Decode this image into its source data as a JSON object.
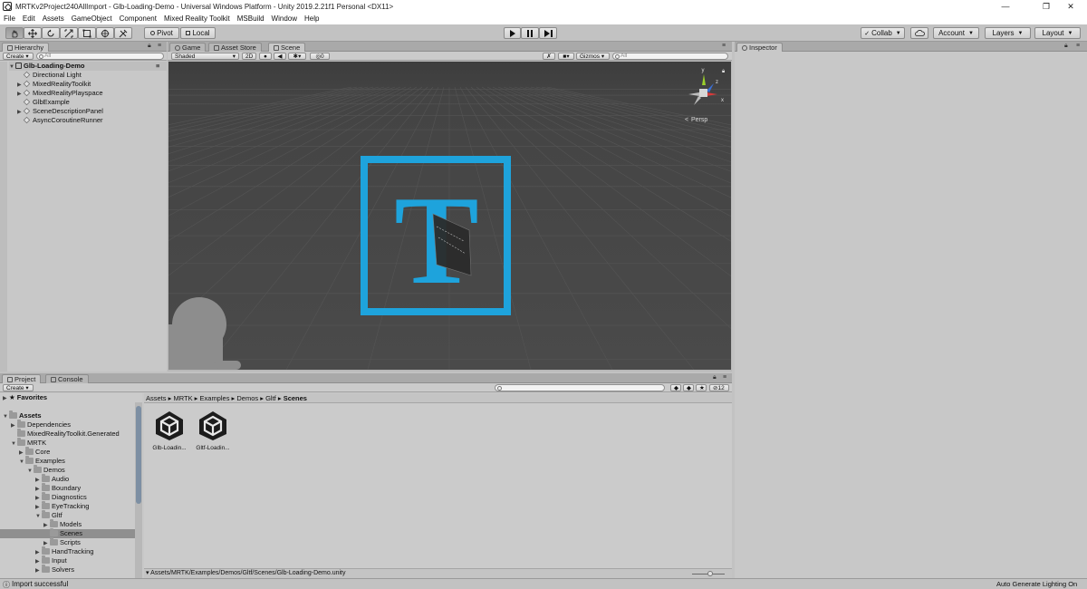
{
  "window": {
    "title": "MRTKv2Project240AllImport - Glb-Loading-Demo - Universal Windows Platform - Unity 2019.2.21f1 Personal <DX11>",
    "minimize_glyph": "—",
    "maximize_glyph": "❐",
    "close_glyph": "✕"
  },
  "menu": [
    "File",
    "Edit",
    "Assets",
    "GameObject",
    "Component",
    "Mixed Reality Toolkit",
    "MSBuild",
    "Window",
    "Help"
  ],
  "toolbar": {
    "pivot_label": "Pivot",
    "local_label": "Local",
    "collab_label": "Collab",
    "account_label": "Account",
    "layers_label": "Layers",
    "layout_label": "Layout"
  },
  "hierarchy": {
    "tab_label": "Hierarchy",
    "create_label": "Create",
    "search_placeholder": "All",
    "scene_name": "Glb-Loading-Demo",
    "items": [
      {
        "label": "Directional Light",
        "expandable": false
      },
      {
        "label": "MixedRealityToolkit",
        "expandable": true
      },
      {
        "label": "MixedRealityPlayspace",
        "expandable": true
      },
      {
        "label": "GlbExample",
        "expandable": false
      },
      {
        "label": "SceneDescriptionPanel",
        "expandable": true
      },
      {
        "label": "AsyncCoroutineRunner",
        "expandable": false
      }
    ]
  },
  "scene_view": {
    "tabs": [
      "Game",
      "Asset Store",
      "Scene"
    ],
    "active_tab": "Scene",
    "shading_mode": "Shaded",
    "mode_2d": "2D",
    "effects_count": "0",
    "gizmos_label": "Gizmos",
    "search_placeholder": "All",
    "projection_label": "Persp",
    "accent_color": "#1ea3dc",
    "axis_y_label": "y",
    "axis_x_label": "x",
    "axis_z_label": "z",
    "center_letter": "T"
  },
  "inspector": {
    "tab_label": "Inspector"
  },
  "project": {
    "tabs": [
      "Project",
      "Console"
    ],
    "create_label": "Create",
    "favorites_label": "Favorites",
    "assets_label": "Assets",
    "icon_size_value": "12",
    "breadcrumb": [
      "Assets",
      "MRTK",
      "Examples",
      "Demos",
      "Gltf",
      "Scenes"
    ],
    "tree": [
      {
        "label": "Dependencies",
        "level": 1,
        "arrow": "▶"
      },
      {
        "label": "MixedRealityToolkit.Generated",
        "level": 1,
        "arrow": ""
      },
      {
        "label": "MRTK",
        "level": 1,
        "arrow": "▼"
      },
      {
        "label": "Core",
        "level": 2,
        "arrow": "▶"
      },
      {
        "label": "Examples",
        "level": 2,
        "arrow": "▼"
      },
      {
        "label": "Demos",
        "level": 3,
        "arrow": "▼"
      },
      {
        "label": "Audio",
        "level": 4,
        "arrow": "▶"
      },
      {
        "label": "Boundary",
        "level": 4,
        "arrow": "▶"
      },
      {
        "label": "Diagnostics",
        "level": 4,
        "arrow": "▶"
      },
      {
        "label": "EyeTracking",
        "level": 4,
        "arrow": "▶"
      },
      {
        "label": "Gltf",
        "level": 4,
        "arrow": "▼"
      },
      {
        "label": "Models",
        "level": 5,
        "arrow": "▶"
      },
      {
        "label": "Scenes",
        "level": 5,
        "arrow": "",
        "selected": true
      },
      {
        "label": "Scripts",
        "level": 5,
        "arrow": "▶"
      },
      {
        "label": "HandTracking",
        "level": 4,
        "arrow": "▶"
      },
      {
        "label": "Input",
        "level": 4,
        "arrow": "▶"
      },
      {
        "label": "Solvers",
        "level": 4,
        "arrow": "▶"
      }
    ],
    "assets": [
      {
        "label": "Glb-Loadin..."
      },
      {
        "label": "Gltf-Loadin..."
      }
    ],
    "selected_path": "Assets/MRTK/Examples/Demos/Gltf/Scenes/Glb-Loading-Demo.unity"
  },
  "status": {
    "message": "Import successful",
    "right_label": "Auto Generate Lighting On"
  }
}
